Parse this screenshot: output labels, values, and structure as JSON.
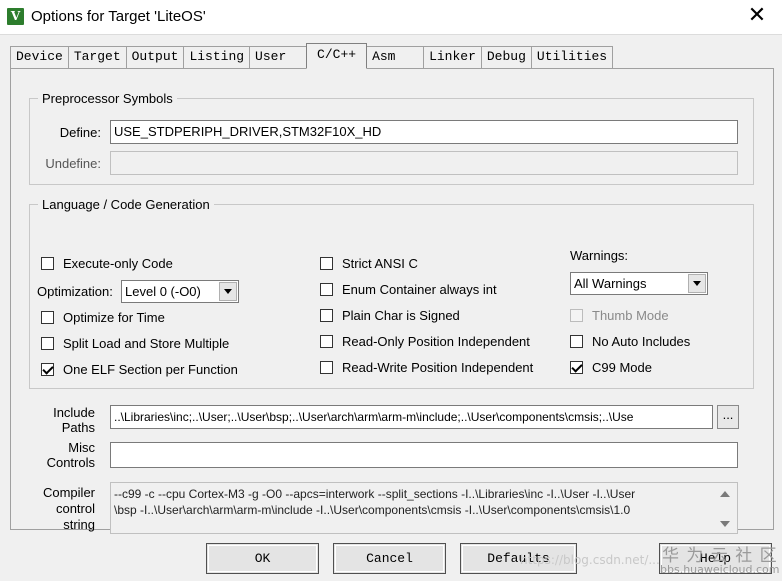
{
  "window": {
    "title": "Options for Target 'LiteOS'",
    "icon": "keil-uvision-icon",
    "close_glyph": "✕"
  },
  "tabs": [
    "Device",
    "Target",
    "Output",
    "Listing",
    "User",
    "C/C++",
    "Asm",
    "Linker",
    "Debug",
    "Utilities"
  ],
  "active_tab": "C/C++",
  "preprocessor": {
    "legend": "Preprocessor Symbols",
    "define_label": "Define:",
    "define_value": "USE_STDPERIPH_DRIVER,STM32F10X_HD",
    "undefine_label": "Undefine:",
    "undefine_value": ""
  },
  "codegen": {
    "legend": "Language / Code Generation",
    "execute_only": {
      "label": "Execute-only Code",
      "checked": false
    },
    "optimization_label": "Optimization:",
    "optimization_value": "Level 0 (-O0)",
    "optimize_time": {
      "label": "Optimize for Time",
      "checked": false
    },
    "split_load": {
      "label": "Split Load and Store Multiple",
      "checked": false
    },
    "one_elf": {
      "label": "One ELF Section per Function",
      "checked": true
    },
    "strict_ansi": {
      "label": "Strict ANSI C",
      "checked": false
    },
    "enum_int": {
      "label": "Enum Container always int",
      "checked": false
    },
    "plain_char": {
      "label": "Plain Char is Signed",
      "checked": false
    },
    "ro_pi": {
      "label": "Read-Only Position Independent",
      "checked": false
    },
    "rw_pi": {
      "label": "Read-Write Position Independent",
      "checked": false
    },
    "warnings_label": "Warnings:",
    "warnings_value": "All Warnings",
    "thumb_mode": {
      "label": "Thumb Mode",
      "checked": false,
      "disabled": true
    },
    "no_auto_includes": {
      "label": "No Auto Includes",
      "checked": false
    },
    "c99_mode": {
      "label": "C99 Mode",
      "checked": true
    }
  },
  "include_paths": {
    "label_line1": "Include",
    "label_line2": "Paths",
    "value": "..\\Libraries\\inc;..\\User;..\\User\\bsp;..\\User\\arch\\arm\\arm-m\\include;..\\User\\components\\cmsis;..\\Use",
    "browse_label": "..."
  },
  "misc_controls": {
    "label_line1": "Misc",
    "label_line2": "Controls",
    "value": ""
  },
  "compiler_string": {
    "label_line1": "Compiler",
    "label_line2": "control",
    "label_line3": "string",
    "line1": "--c99 -c --cpu Cortex-M3 -g -O0 --apcs=interwork --split_sections -I..\\Libraries\\inc -I..\\User -I..\\User",
    "line2": "\\bsp -I..\\User\\arch\\arm\\arm-m\\include -I..\\User\\components\\cmsis -I..\\User\\components\\cmsis\\1.0"
  },
  "buttons": {
    "ok": "OK",
    "cancel": "Cancel",
    "defaults": "Defaults",
    "help": "Help"
  },
  "watermark": {
    "line1": "华 为 云 社 区",
    "line2": "bbs.huaweicloud.com",
    "url": "https://blog.csdn.net/..."
  },
  "colors": {
    "dialog_bg": "#f0f0f0",
    "title_bg": "#ffffff",
    "field_bg": "#ffffff"
  }
}
